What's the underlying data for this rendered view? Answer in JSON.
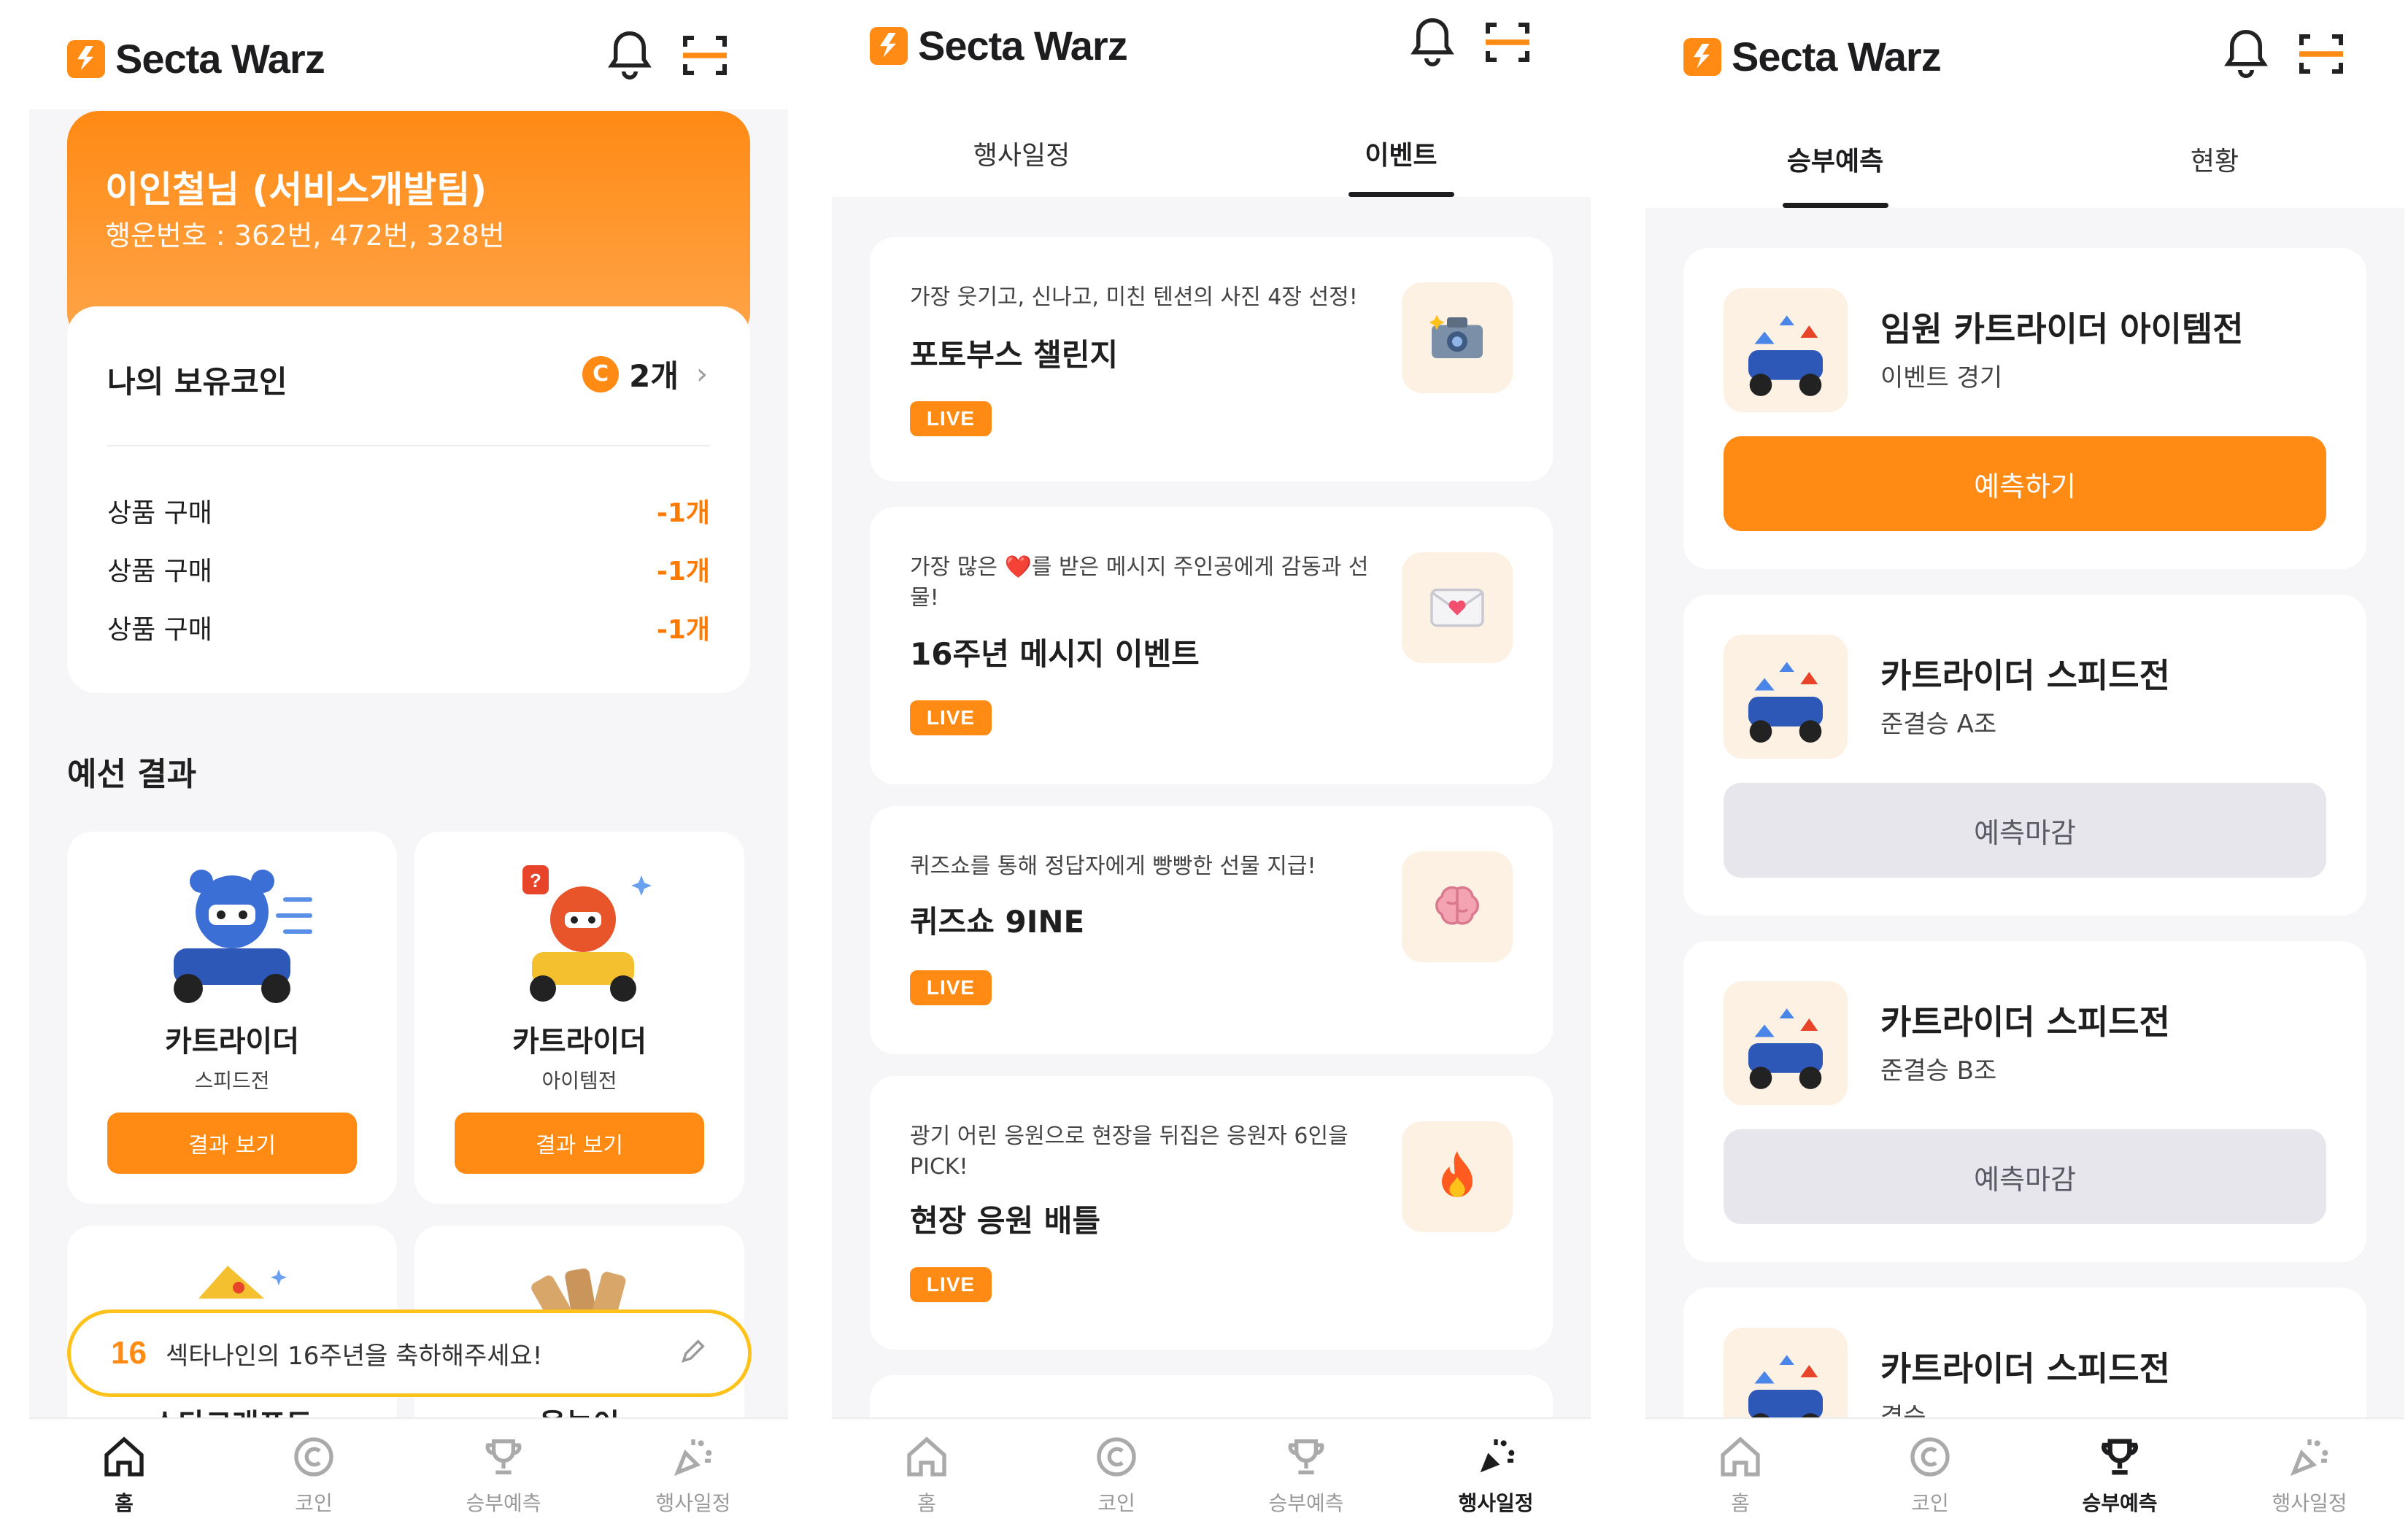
{
  "brand": {
    "name": "Secta Warz"
  },
  "nav": [
    {
      "label": "홈",
      "icon": "home-icon"
    },
    {
      "label": "코인",
      "icon": "coin-icon"
    },
    {
      "label": "승부예측",
      "icon": "trophy-icon"
    },
    {
      "label": "행사일정",
      "icon": "party-icon"
    }
  ],
  "home": {
    "hero": {
      "name": "이인철님 (서비스개발팀)",
      "lucky_numbers": "행운번호 : 362번, 472번, 328번"
    },
    "coin": {
      "title": "나의 보유코인",
      "badge": "C",
      "amount": "2개"
    },
    "transactions": [
      {
        "label": "상품 구매",
        "amount": "-1개"
      },
      {
        "label": "상품 구매",
        "amount": "-1개"
      },
      {
        "label": "상품 구매",
        "amount": "-1개"
      }
    ],
    "section_title": "예선 결과",
    "games": [
      {
        "name": "카트라이더",
        "sub": "스피드전",
        "button": "결과 보기"
      },
      {
        "name": "카트라이더",
        "sub": "아이템전",
        "button": "결과 보기"
      }
    ],
    "games_row2": [
      {
        "name": "스타크래프트"
      },
      {
        "name": "윷놀이"
      }
    ],
    "banner": {
      "badge": "16",
      "text": "섹타나인의 16주년을 축하해주세요!"
    }
  },
  "events": {
    "tabs": [
      {
        "label": "행사일정"
      },
      {
        "label": "이벤트"
      }
    ],
    "active_tab": 1,
    "items": [
      {
        "desc": "가장 웃기고, 신나고, 미친 텐션의 사진 4장 선정!",
        "title": "포토부스 챌린지",
        "badge": "LIVE",
        "icon": "camera-icon"
      },
      {
        "desc": "가장 많은 ❤️를 받은 메시지 주인공에게 감동과 선물!",
        "title": "16주년 메시지 이벤트",
        "badge": "LIVE",
        "icon": "envelope-icon"
      },
      {
        "desc": "퀴즈쇼를 통해 정답자에게 빵빵한 선물 지급!",
        "title": "퀴즈쇼 9INE",
        "badge": "LIVE",
        "icon": "brain-icon"
      },
      {
        "desc": "광기 어린 응원으로 현장을 뒤집은 응원자 6인을 PICK!",
        "title": "현장 응원 배틀",
        "badge": "LIVE",
        "icon": "fire-icon"
      }
    ]
  },
  "predictions": {
    "tabs": [
      {
        "label": "승부예측"
      },
      {
        "label": "현황"
      }
    ],
    "active_tab": 0,
    "matches": [
      {
        "title": "임원 카트라이더 아이템전",
        "sub": "이벤트 경기",
        "button": "예측하기",
        "state": "open"
      },
      {
        "title": "카트라이더 스피드전",
        "sub": "준결승 A조",
        "button": "예측마감",
        "state": "closed"
      },
      {
        "title": "카트라이더 스피드전",
        "sub": "준결승 B조",
        "button": "예측마감",
        "state": "closed"
      },
      {
        "title": "카트라이더 스피드전",
        "sub": "결승"
      }
    ]
  },
  "colors": {
    "accent": "#ff8a14",
    "banner_border": "#ffc21a",
    "closed_button": "#e6e6ec"
  }
}
